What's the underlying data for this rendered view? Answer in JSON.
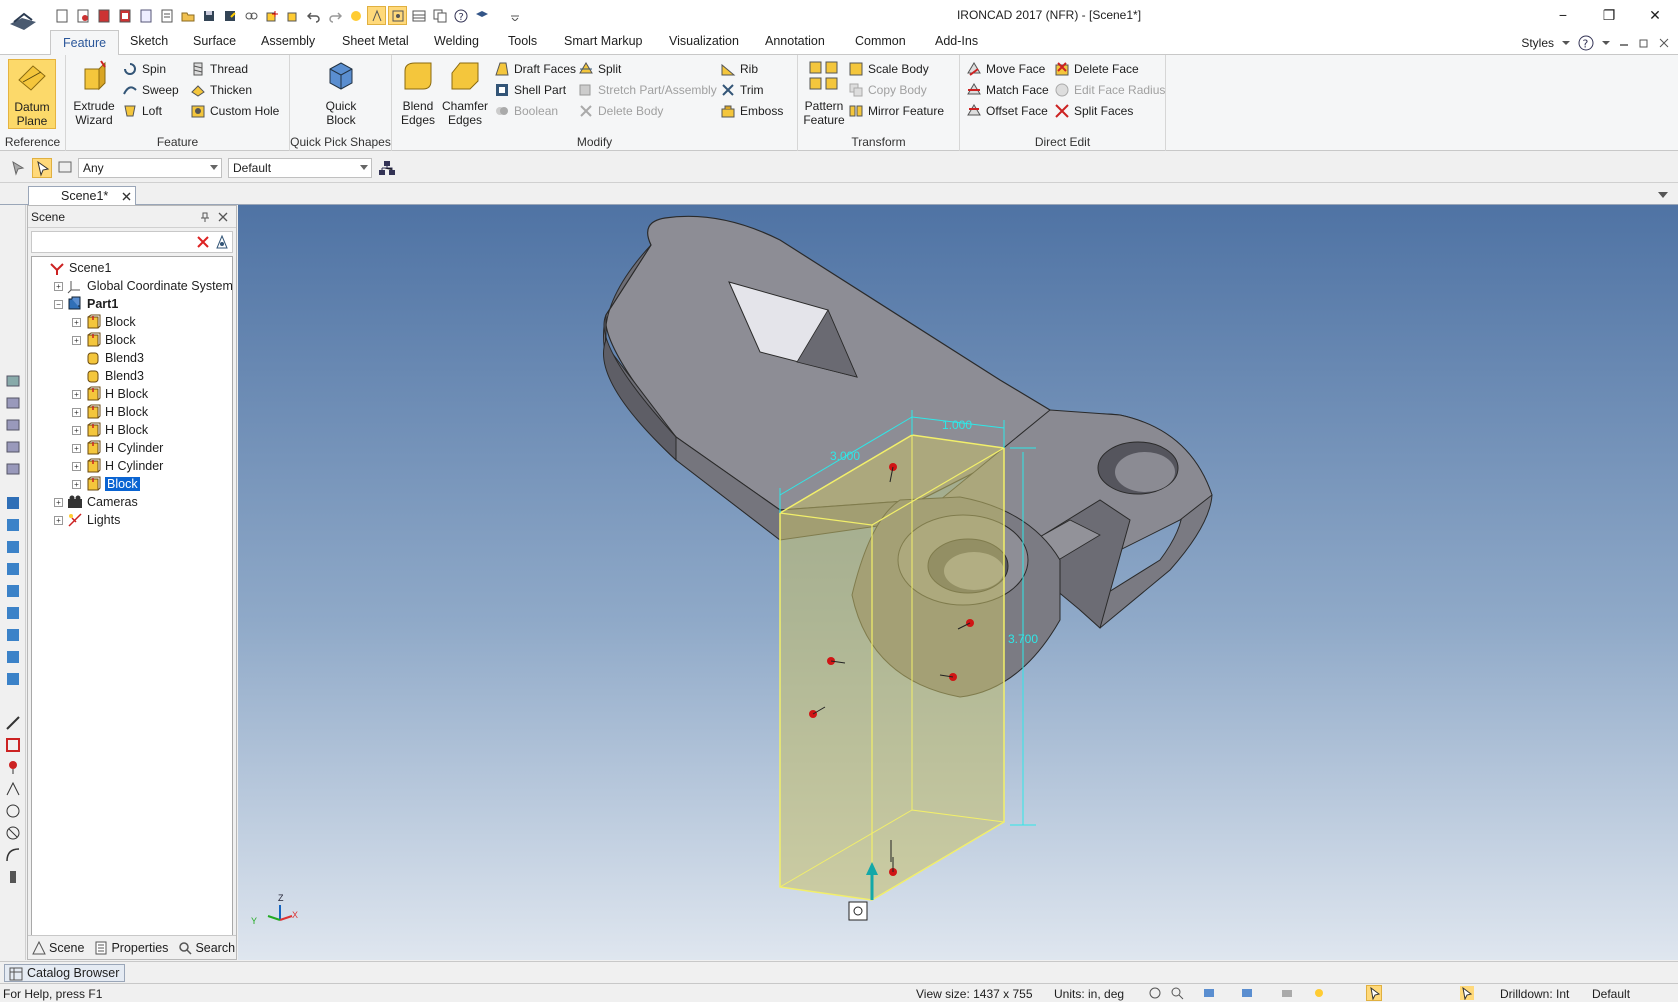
{
  "window": {
    "title": "IRONCAD 2017 (NFR) - [Scene1*]",
    "minimize": "−",
    "restore": "❐",
    "close": "✕"
  },
  "ribbon_tabs": [
    "Feature",
    "Sketch",
    "Surface",
    "Assembly",
    "Sheet Metal",
    "Welding",
    "Tools",
    "Smart Markup",
    "Visualization",
    "Annotation",
    "Common",
    "Add-Ins"
  ],
  "ribbon_right": {
    "styles": "Styles"
  },
  "groups": {
    "reference": {
      "label": "Reference",
      "datum_plane": "Datum Plane"
    },
    "feature": {
      "label": "Feature",
      "extrude_wizard": "Extrude Wizard",
      "spin": "Spin",
      "sweep": "Sweep",
      "loft": "Loft",
      "thread": "Thread",
      "thicken": "Thicken",
      "custom_hole": "Custom Hole"
    },
    "quick_pick": {
      "label": "Quick Pick Shapes",
      "quick_block": "Quick Block"
    },
    "modify": {
      "label": "Modify",
      "blend_edges": "Blend Edges",
      "chamfer_edges": "Chamfer Edges",
      "draft_faces": "Draft Faces",
      "shell_part": "Shell Part",
      "boolean": "Boolean",
      "split": "Split",
      "stretch": "Stretch Part/Assembly",
      "delete_body": "Delete Body",
      "rib": "Rib",
      "trim": "Trim",
      "emboss": "Emboss"
    },
    "transform": {
      "label": "Transform",
      "pattern_feature": "Pattern Feature",
      "scale_body": "Scale Body",
      "copy_body": "Copy Body",
      "mirror_feature": "Mirror Feature"
    },
    "direct_edit": {
      "label": "Direct Edit",
      "move_face": "Move Face",
      "match_face": "Match Face",
      "offset_face": "Offset Face",
      "delete_face": "Delete Face",
      "edit_face_radius": "Edit Face Radius",
      "split_faces": "Split Faces"
    }
  },
  "selection_toolbar": {
    "filter": "Any",
    "style": "Default"
  },
  "doc_tab": "Scene1*",
  "scene_panel": {
    "title": "Scene",
    "tree": [
      {
        "label": "Scene1",
        "level": 0,
        "expander": "",
        "icon": "scene-icon",
        "bold": false,
        "selected": false
      },
      {
        "label": "Global Coordinate System",
        "level": 1,
        "expander": "+",
        "icon": "axes-icon",
        "bold": false,
        "selected": false
      },
      {
        "label": "Part1",
        "level": 1,
        "expander": "−",
        "icon": "part-icon",
        "bold": true,
        "selected": false
      },
      {
        "label": "Block",
        "level": 2,
        "expander": "+",
        "icon": "block-icon",
        "bold": false,
        "selected": false
      },
      {
        "label": "Block",
        "level": 2,
        "expander": "+",
        "icon": "block-icon",
        "bold": false,
        "selected": false
      },
      {
        "label": "Blend3",
        "level": 2,
        "expander": "",
        "icon": "blend-icon",
        "bold": false,
        "selected": false
      },
      {
        "label": "Blend3",
        "level": 2,
        "expander": "",
        "icon": "blend-icon",
        "bold": false,
        "selected": false
      },
      {
        "label": "H Block",
        "level": 2,
        "expander": "+",
        "icon": "block-icon",
        "bold": false,
        "selected": false
      },
      {
        "label": "H Block",
        "level": 2,
        "expander": "+",
        "icon": "block-icon",
        "bold": false,
        "selected": false
      },
      {
        "label": "H Block",
        "level": 2,
        "expander": "+",
        "icon": "block-icon",
        "bold": false,
        "selected": false
      },
      {
        "label": "H Cylinder",
        "level": 2,
        "expander": "+",
        "icon": "block-icon",
        "bold": false,
        "selected": false
      },
      {
        "label": "H Cylinder",
        "level": 2,
        "expander": "+",
        "icon": "block-icon",
        "bold": false,
        "selected": false
      },
      {
        "label": "Block",
        "level": 2,
        "expander": "+",
        "icon": "block-icon",
        "bold": false,
        "selected": true
      },
      {
        "label": "Cameras",
        "level": 1,
        "expander": "+",
        "icon": "camera-icon",
        "bold": false,
        "selected": false
      },
      {
        "label": "Lights",
        "level": 1,
        "expander": "+",
        "icon": "light-icon",
        "bold": false,
        "selected": false
      }
    ],
    "tabs": [
      "Scene",
      "Properties",
      "Search"
    ]
  },
  "viewport": {
    "dimensions": [
      "1.000",
      "3.000",
      "3.700"
    ],
    "triad": {
      "z": "Z",
      "x": "X",
      "y": "Y"
    }
  },
  "catalog_browser": "Catalog Browser",
  "status": {
    "help": "For Help, press F1",
    "view_size": "View size: 1437 x 755",
    "units": "Units: in, deg",
    "drilldown": "Drilldown: Int",
    "style": "Default"
  }
}
